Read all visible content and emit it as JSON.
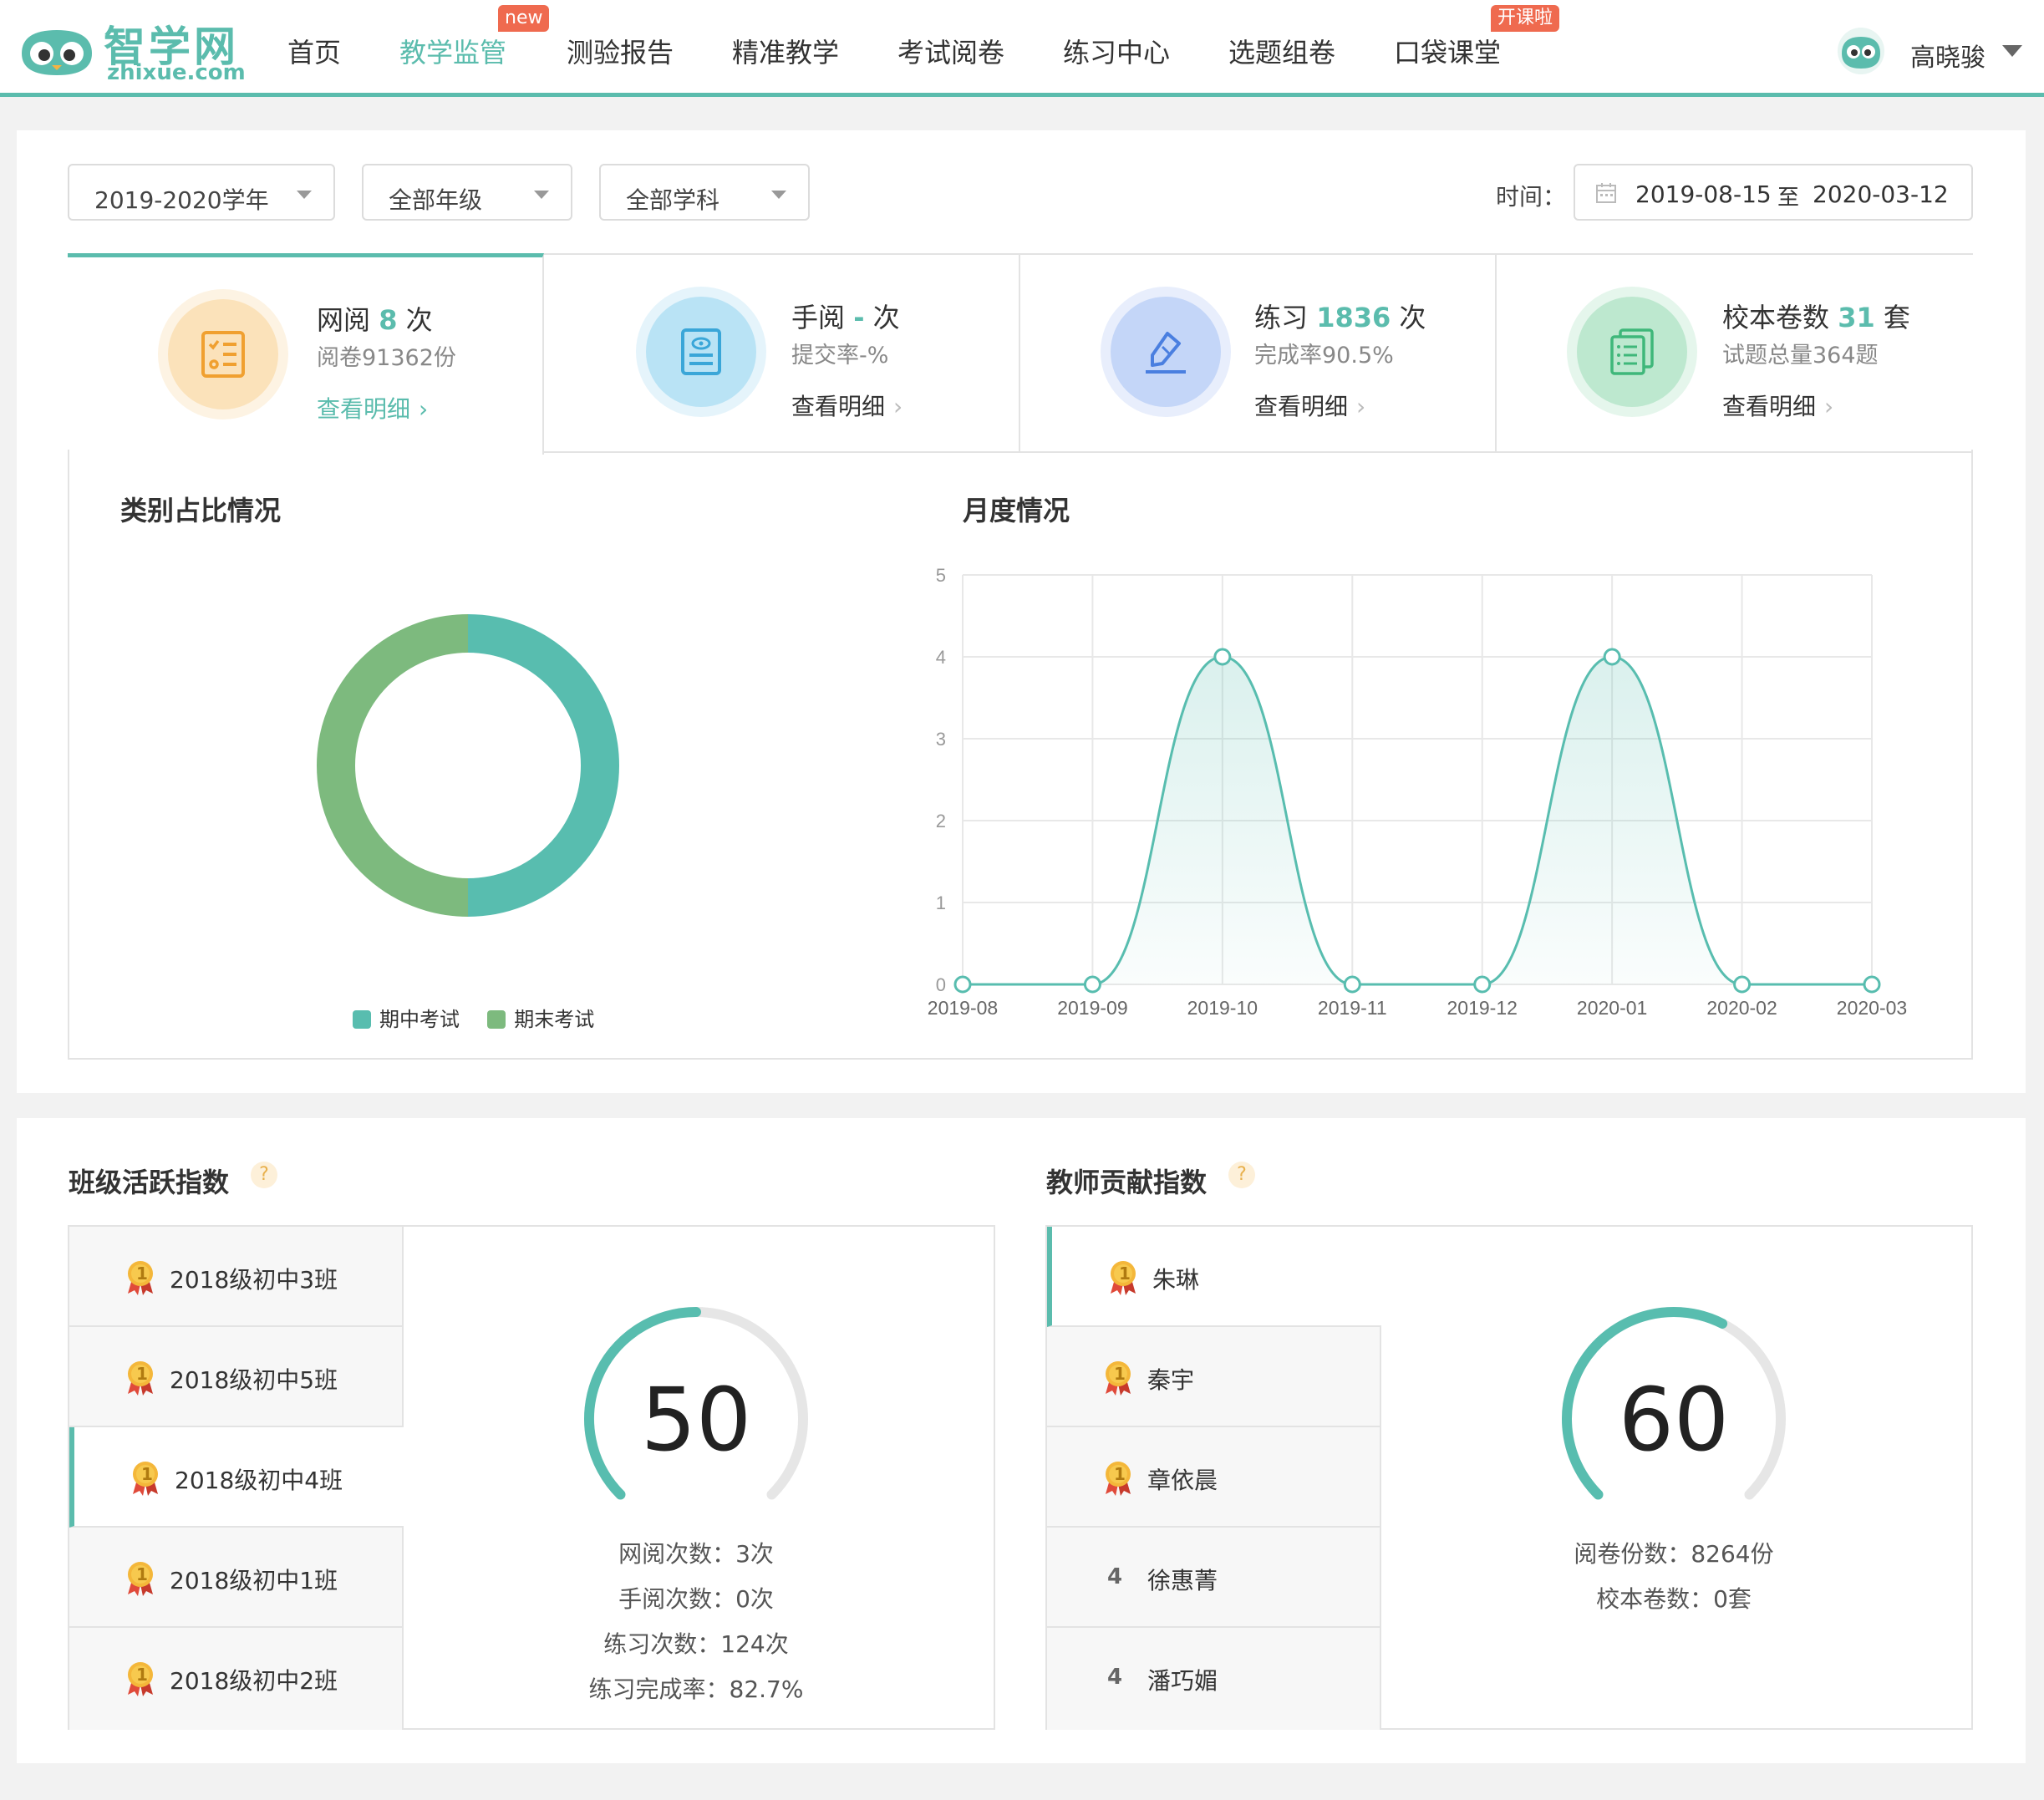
{
  "header": {
    "logo_text": "智学网",
    "logo_sub": "zhixue.com",
    "nav": [
      {
        "label": "首页"
      },
      {
        "label": "教学监管",
        "badge": "new"
      },
      {
        "label": "测验报告"
      },
      {
        "label": "精准教学"
      },
      {
        "label": "考试阅卷"
      },
      {
        "label": "练习中心"
      },
      {
        "label": "选题组卷"
      },
      {
        "label": "口袋课堂",
        "badge": "开课啦"
      }
    ],
    "user_name": "高晓骏"
  },
  "filters": {
    "year": "2019-2020学年",
    "grade": "全部年级",
    "subject": "全部学科",
    "time_label": "时间：",
    "date_start": "2019-08-15",
    "date_sep": "至",
    "date_end": "2020-03-12"
  },
  "stats": [
    {
      "title_pre": "网阅",
      "num": "8",
      "title_post": "次",
      "sub": "阅卷91362份",
      "link": "查看明细"
    },
    {
      "title_pre": "手阅",
      "num": "-",
      "title_post": "次",
      "sub": "提交率-%",
      "link": "查看明细"
    },
    {
      "title_pre": "练习",
      "num": "1836",
      "title_post": "次",
      "sub": "完成率90.5%",
      "link": "查看明细"
    },
    {
      "title_pre": "校本卷数",
      "num": "31",
      "title_post": "套",
      "sub": "试题总量364题",
      "link": "查看明细"
    }
  ],
  "category_title": "类别占比情况",
  "monthly_title": "月度情况",
  "chart_data": [
    {
      "type": "pie",
      "categories": [
        "期中考试",
        "期末考试"
      ],
      "values": [
        50,
        50
      ],
      "colors": [
        "#58bdaf",
        "#7dba7e"
      ],
      "legend_position": "bottom"
    },
    {
      "type": "area",
      "categories": [
        "2019-08",
        "2019-09",
        "2019-10",
        "2019-11",
        "2019-12",
        "2020-01",
        "2020-02",
        "2020-03"
      ],
      "values": [
        0,
        0,
        4,
        0,
        0,
        4,
        0,
        0
      ],
      "ylim": [
        0,
        5
      ],
      "yticks": [
        "0",
        "1",
        "2",
        "3",
        "4",
        "5"
      ],
      "grid": true,
      "color": "#58bdaf"
    }
  ],
  "class_activity": {
    "title": "班级活跃指数",
    "help": "?",
    "items": [
      {
        "medal": "1",
        "label": "2018级初中3班"
      },
      {
        "medal": "1",
        "label": "2018级初中5班"
      },
      {
        "medal": "1",
        "label": "2018级初中4班"
      },
      {
        "medal": "1",
        "label": "2018级初中1班"
      },
      {
        "medal": "1",
        "label": "2018级初中2班"
      }
    ],
    "score": "50",
    "score_fraction": 0.5,
    "details": [
      "网阅次数：3次",
      "手阅次数：0次",
      "练习次数：124次",
      "练习完成率：82.7%"
    ]
  },
  "teacher_contrib": {
    "title": "教师贡献指数",
    "help": "?",
    "items": [
      {
        "medal": "1",
        "label": "朱琳"
      },
      {
        "medal": "1",
        "label": "秦宇"
      },
      {
        "medal": "1",
        "label": "章依晨"
      },
      {
        "rank": "4",
        "label": "徐惠菁"
      },
      {
        "rank": "4",
        "label": "潘巧媚"
      }
    ],
    "score": "60",
    "score_fraction": 0.6,
    "details": [
      "阅卷份数：8264份",
      "校本卷数：0套"
    ]
  }
}
